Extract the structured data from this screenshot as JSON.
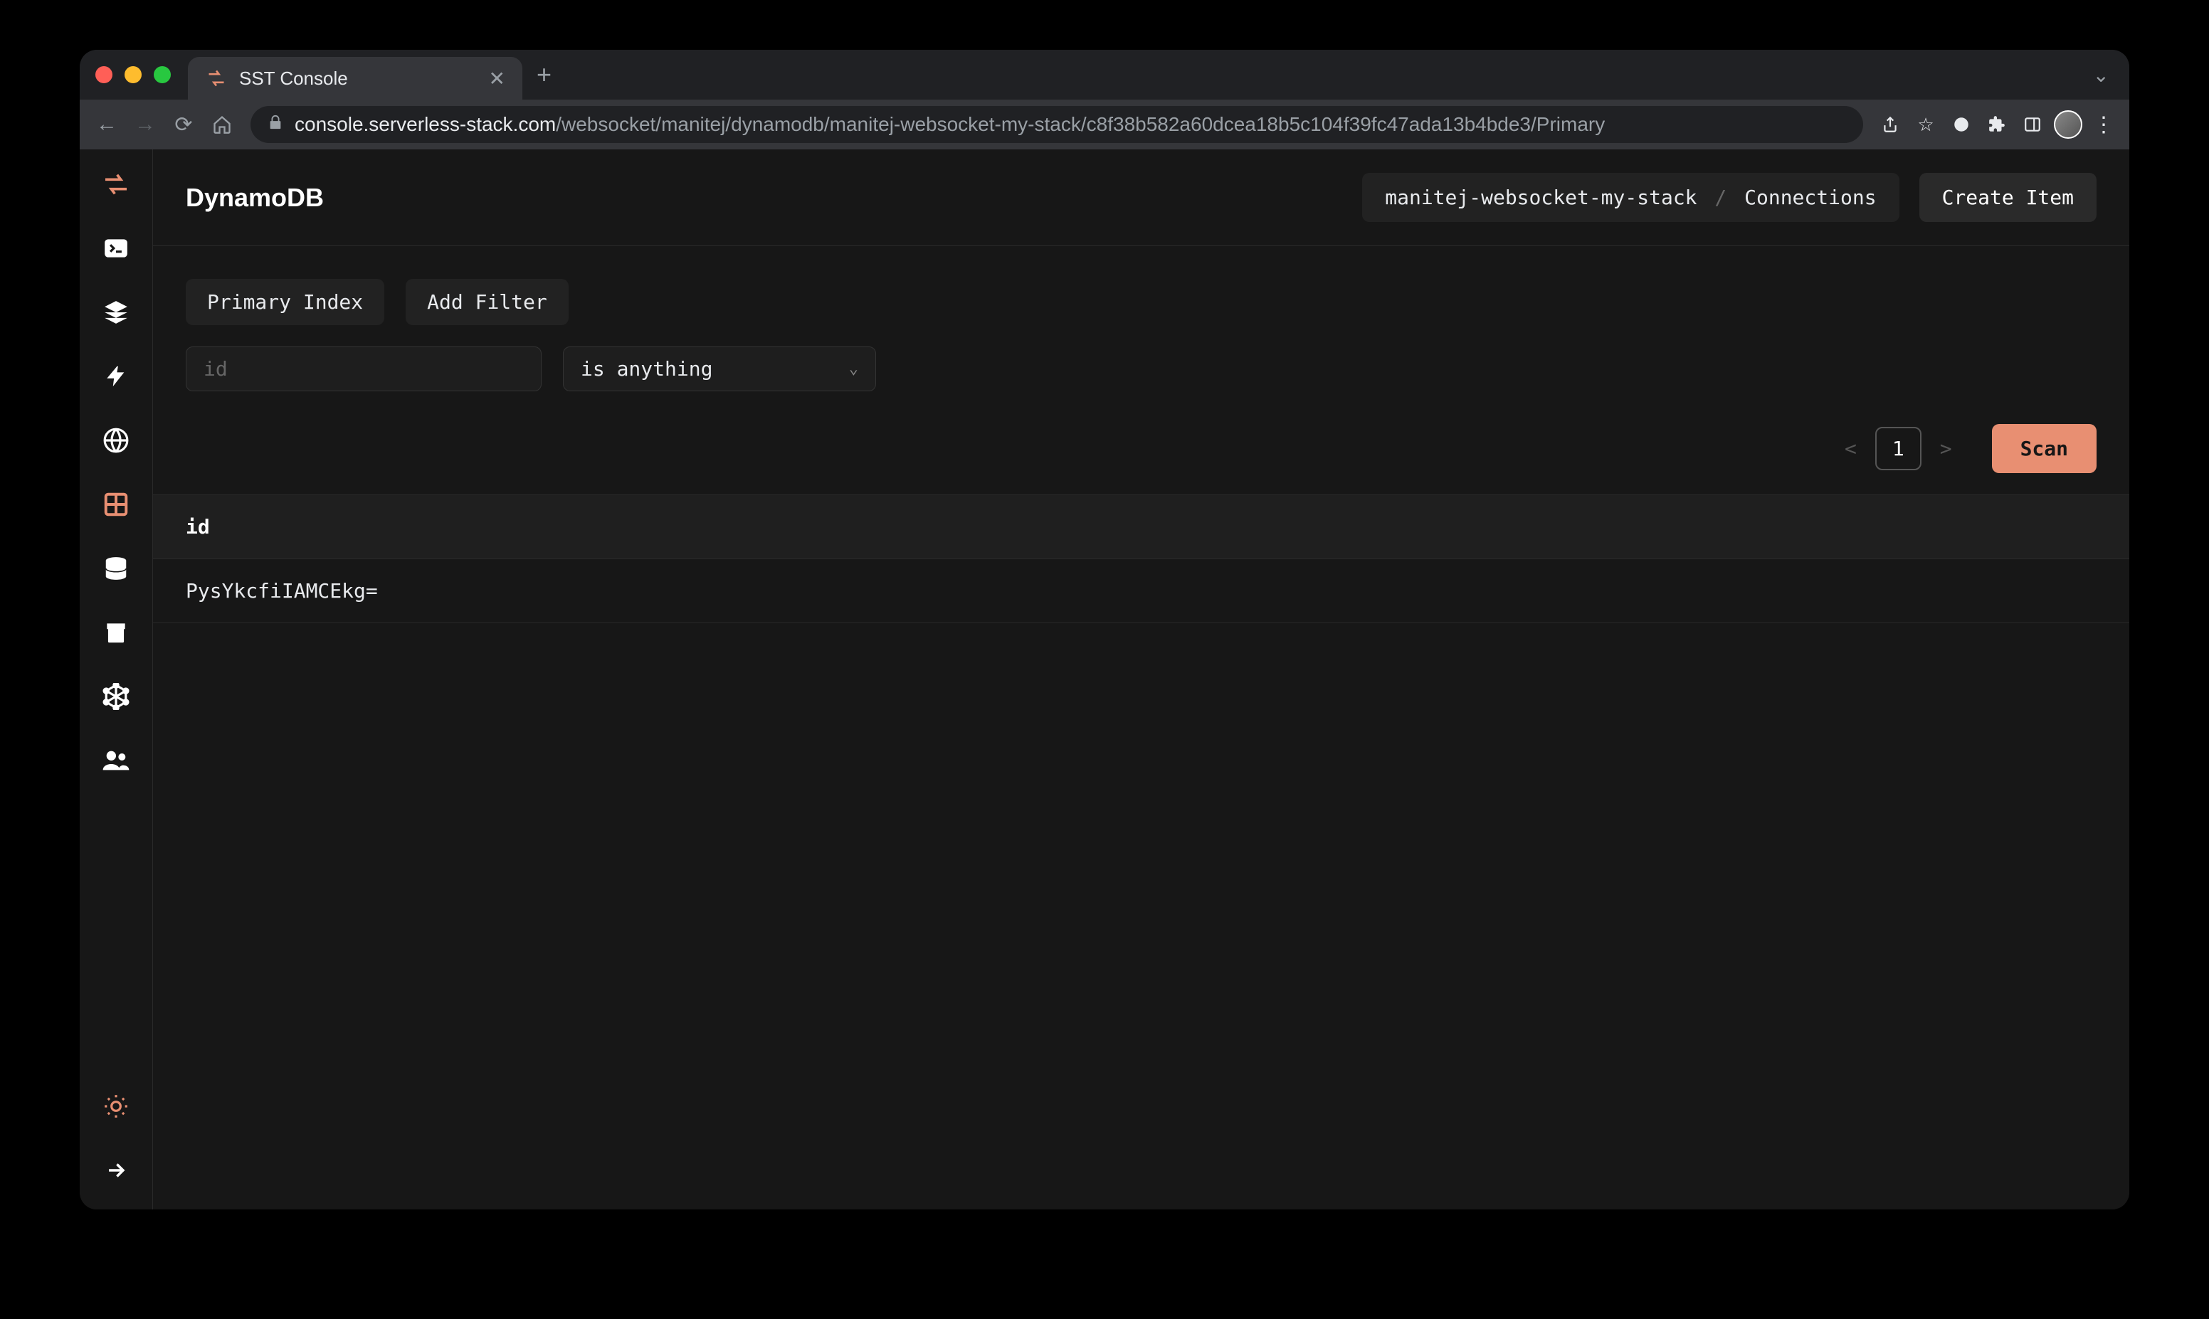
{
  "browser": {
    "tab_title": "SST Console",
    "url_host": "console.serverless-stack.com",
    "url_path": "/websocket/manitej/dynamodb/manitej-websocket-my-stack/c8f38b582a60dcea18b5c104f39fc47ada13b4bde3/Primary"
  },
  "header": {
    "title": "DynamoDB",
    "breadcrumb_stack": "manitej-websocket-my-stack",
    "breadcrumb_table": "Connections",
    "create_item_label": "Create Item"
  },
  "filters": {
    "primary_index_label": "Primary Index",
    "add_filter_label": "Add Filter",
    "input_placeholder": "id",
    "select_value": "is anything"
  },
  "pagination": {
    "prev": "<",
    "current": "1",
    "next": ">"
  },
  "actions": {
    "scan_label": "Scan"
  },
  "table": {
    "columns": [
      "id"
    ],
    "rows": [
      {
        "id": "PysYkcfiIAMCEkg="
      }
    ]
  },
  "colors": {
    "accent": "#e88f72",
    "bg": "#171717"
  }
}
